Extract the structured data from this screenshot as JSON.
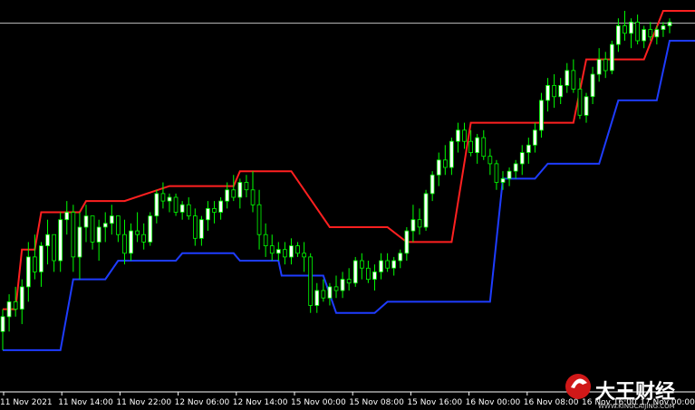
{
  "chart_data": {
    "type": "candlestick",
    "x_tick_labels": [
      "11 Nov 2021",
      "11 Nov 14:00",
      "11 Nov 22:00",
      "12 Nov 06:00",
      "12 Nov 14:00",
      "15 Nov 00:00",
      "15 Nov 08:00",
      "15 Nov 16:00",
      "16 Nov 00:00",
      "16 Nov 08:00",
      "16 Nov 16:00",
      "17 Nov 00:00"
    ],
    "y_range": [
      0,
      100
    ],
    "grid": false,
    "colors": {
      "background": "#000000",
      "bull_candle": "#ffffff",
      "bear_candle": "#00ff00",
      "wick": "#00ff00",
      "upper_channel": "#ff2020",
      "lower_channel": "#1e3cff",
      "price_line": "#c0c0c0"
    },
    "current_price": 96.7,
    "candles": [
      {
        "o": 14,
        "h": 20,
        "l": 9,
        "c": 18
      },
      {
        "o": 18,
        "h": 24,
        "l": 14,
        "c": 22
      },
      {
        "o": 22,
        "h": 26,
        "l": 18,
        "c": 20
      },
      {
        "o": 20,
        "h": 28,
        "l": 16,
        "c": 26
      },
      {
        "o": 26,
        "h": 38,
        "l": 22,
        "c": 34
      },
      {
        "o": 34,
        "h": 40,
        "l": 28,
        "c": 30
      },
      {
        "o": 30,
        "h": 38,
        "l": 26,
        "c": 37
      },
      {
        "o": 37,
        "h": 44,
        "l": 32,
        "c": 40
      },
      {
        "o": 40,
        "h": 40,
        "l": 30,
        "c": 33
      },
      {
        "o": 33,
        "h": 46,
        "l": 30,
        "c": 44
      },
      {
        "o": 44,
        "h": 49,
        "l": 40,
        "c": 46
      },
      {
        "o": 46,
        "h": 48,
        "l": 30,
        "c": 34
      },
      {
        "o": 34,
        "h": 46,
        "l": 28,
        "c": 42
      },
      {
        "o": 42,
        "h": 48,
        "l": 38,
        "c": 45
      },
      {
        "o": 45,
        "h": 45,
        "l": 36,
        "c": 38
      },
      {
        "o": 38,
        "h": 44,
        "l": 33,
        "c": 42
      },
      {
        "o": 42,
        "h": 46,
        "l": 38,
        "c": 43
      },
      {
        "o": 43,
        "h": 48,
        "l": 40,
        "c": 45
      },
      {
        "o": 45,
        "h": 45,
        "l": 38,
        "c": 40
      },
      {
        "o": 40,
        "h": 44,
        "l": 32,
        "c": 35
      },
      {
        "o": 35,
        "h": 43,
        "l": 33,
        "c": 41
      },
      {
        "o": 41,
        "h": 46,
        "l": 38,
        "c": 40
      },
      {
        "o": 40,
        "h": 43,
        "l": 36,
        "c": 38
      },
      {
        "o": 38,
        "h": 46,
        "l": 37,
        "c": 45
      },
      {
        "o": 45,
        "h": 52,
        "l": 43,
        "c": 51
      },
      {
        "o": 51,
        "h": 54,
        "l": 47,
        "c": 49
      },
      {
        "o": 49,
        "h": 51,
        "l": 46,
        "c": 50
      },
      {
        "o": 50,
        "h": 51,
        "l": 45,
        "c": 46
      },
      {
        "o": 46,
        "h": 49,
        "l": 44,
        "c": 48
      },
      {
        "o": 48,
        "h": 50,
        "l": 44,
        "c": 45
      },
      {
        "o": 45,
        "h": 47,
        "l": 37,
        "c": 39
      },
      {
        "o": 39,
        "h": 45,
        "l": 37,
        "c": 44
      },
      {
        "o": 44,
        "h": 49,
        "l": 41,
        "c": 47
      },
      {
        "o": 47,
        "h": 49,
        "l": 43,
        "c": 46
      },
      {
        "o": 46,
        "h": 50,
        "l": 44,
        "c": 49
      },
      {
        "o": 49,
        "h": 54,
        "l": 47,
        "c": 52
      },
      {
        "o": 52,
        "h": 56,
        "l": 49,
        "c": 50
      },
      {
        "o": 50,
        "h": 55,
        "l": 47,
        "c": 54
      },
      {
        "o": 54,
        "h": 56,
        "l": 50,
        "c": 52
      },
      {
        "o": 52,
        "h": 57,
        "l": 46,
        "c": 48
      },
      {
        "o": 48,
        "h": 52,
        "l": 36,
        "c": 40
      },
      {
        "o": 40,
        "h": 43,
        "l": 34,
        "c": 37
      },
      {
        "o": 37,
        "h": 40,
        "l": 33,
        "c": 35
      },
      {
        "o": 35,
        "h": 38,
        "l": 33,
        "c": 36
      },
      {
        "o": 36,
        "h": 38,
        "l": 32,
        "c": 34
      },
      {
        "o": 34,
        "h": 39,
        "l": 32,
        "c": 37
      },
      {
        "o": 37,
        "h": 38,
        "l": 34,
        "c": 35
      },
      {
        "o": 35,
        "h": 38,
        "l": 30,
        "c": 34
      },
      {
        "o": 34,
        "h": 35,
        "l": 19,
        "c": 21
      },
      {
        "o": 21,
        "h": 27,
        "l": 19,
        "c": 25
      },
      {
        "o": 25,
        "h": 28,
        "l": 22,
        "c": 23
      },
      {
        "o": 23,
        "h": 27,
        "l": 21,
        "c": 26
      },
      {
        "o": 26,
        "h": 29,
        "l": 23,
        "c": 25
      },
      {
        "o": 25,
        "h": 30,
        "l": 23,
        "c": 28
      },
      {
        "o": 28,
        "h": 31,
        "l": 25,
        "c": 27
      },
      {
        "o": 27,
        "h": 34,
        "l": 26,
        "c": 33
      },
      {
        "o": 33,
        "h": 35,
        "l": 28,
        "c": 31
      },
      {
        "o": 31,
        "h": 33,
        "l": 27,
        "c": 28
      },
      {
        "o": 28,
        "h": 32,
        "l": 25,
        "c": 30
      },
      {
        "o": 30,
        "h": 35,
        "l": 28,
        "c": 33
      },
      {
        "o": 33,
        "h": 35,
        "l": 30,
        "c": 31
      },
      {
        "o": 31,
        "h": 34,
        "l": 29,
        "c": 33
      },
      {
        "o": 33,
        "h": 36,
        "l": 31,
        "c": 35
      },
      {
        "o": 35,
        "h": 42,
        "l": 33,
        "c": 41
      },
      {
        "o": 41,
        "h": 48,
        "l": 38,
        "c": 44
      },
      {
        "o": 44,
        "h": 47,
        "l": 40,
        "c": 42
      },
      {
        "o": 42,
        "h": 52,
        "l": 41,
        "c": 51
      },
      {
        "o": 51,
        "h": 57,
        "l": 49,
        "c": 56
      },
      {
        "o": 56,
        "h": 62,
        "l": 53,
        "c": 60
      },
      {
        "o": 60,
        "h": 64,
        "l": 56,
        "c": 58
      },
      {
        "o": 58,
        "h": 66,
        "l": 56,
        "c": 65
      },
      {
        "o": 65,
        "h": 70,
        "l": 62,
        "c": 68
      },
      {
        "o": 68,
        "h": 70,
        "l": 63,
        "c": 65
      },
      {
        "o": 65,
        "h": 68,
        "l": 61,
        "c": 62
      },
      {
        "o": 62,
        "h": 67,
        "l": 59,
        "c": 66
      },
      {
        "o": 66,
        "h": 68,
        "l": 60,
        "c": 61
      },
      {
        "o": 61,
        "h": 63,
        "l": 56,
        "c": 59
      },
      {
        "o": 59,
        "h": 60,
        "l": 52,
        "c": 54
      },
      {
        "o": 54,
        "h": 57,
        "l": 52,
        "c": 55
      },
      {
        "o": 55,
        "h": 58,
        "l": 53,
        "c": 57
      },
      {
        "o": 57,
        "h": 60,
        "l": 55,
        "c": 59
      },
      {
        "o": 59,
        "h": 64,
        "l": 56,
        "c": 62
      },
      {
        "o": 62,
        "h": 66,
        "l": 59,
        "c": 64
      },
      {
        "o": 64,
        "h": 70,
        "l": 62,
        "c": 68
      },
      {
        "o": 68,
        "h": 78,
        "l": 66,
        "c": 76
      },
      {
        "o": 76,
        "h": 82,
        "l": 73,
        "c": 80
      },
      {
        "o": 80,
        "h": 83,
        "l": 74,
        "c": 77
      },
      {
        "o": 77,
        "h": 82,
        "l": 75,
        "c": 80
      },
      {
        "o": 80,
        "h": 86,
        "l": 78,
        "c": 84
      },
      {
        "o": 84,
        "h": 87,
        "l": 78,
        "c": 79
      },
      {
        "o": 79,
        "h": 82,
        "l": 71,
        "c": 72
      },
      {
        "o": 72,
        "h": 78,
        "l": 70,
        "c": 77
      },
      {
        "o": 77,
        "h": 85,
        "l": 75,
        "c": 83
      },
      {
        "o": 83,
        "h": 90,
        "l": 81,
        "c": 87
      },
      {
        "o": 87,
        "h": 89,
        "l": 82,
        "c": 84
      },
      {
        "o": 84,
        "h": 92,
        "l": 83,
        "c": 91
      },
      {
        "o": 91,
        "h": 98,
        "l": 89,
        "c": 96
      },
      {
        "o": 96,
        "h": 100,
        "l": 92,
        "c": 94
      },
      {
        "o": 94,
        "h": 98,
        "l": 90,
        "c": 97
      },
      {
        "o": 97,
        "h": 99,
        "l": 91,
        "c": 92
      },
      {
        "o": 92,
        "h": 96,
        "l": 90,
        "c": 95
      },
      {
        "o": 95,
        "h": 97,
        "l": 92,
        "c": 93
      },
      {
        "o": 93,
        "h": 96,
        "l": 91,
        "c": 95
      },
      {
        "o": 95,
        "h": 97,
        "l": 93,
        "c": 96
      },
      {
        "o": 96,
        "h": 98,
        "l": 94,
        "c": 97
      }
    ],
    "upper_channel": [
      {
        "i": 0,
        "v": 20
      },
      {
        "i": 2,
        "v": 20
      },
      {
        "i": 3,
        "v": 36
      },
      {
        "i": 5,
        "v": 36
      },
      {
        "i": 6,
        "v": 46
      },
      {
        "i": 12,
        "v": 46
      },
      {
        "i": 13,
        "v": 49
      },
      {
        "i": 18,
        "v": 49
      },
      {
        "i": 19,
        "v": 49
      },
      {
        "i": 26,
        "v": 53
      },
      {
        "i": 36,
        "v": 53
      },
      {
        "i": 37,
        "v": 57
      },
      {
        "i": 45,
        "v": 57
      },
      {
        "i": 51,
        "v": 42
      },
      {
        "i": 60,
        "v": 42
      },
      {
        "i": 63,
        "v": 38
      },
      {
        "i": 70,
        "v": 38
      },
      {
        "i": 73,
        "v": 70
      },
      {
        "i": 89,
        "v": 70
      },
      {
        "i": 91,
        "v": 87
      },
      {
        "i": 100,
        "v": 87
      },
      {
        "i": 103,
        "v": 100
      },
      {
        "i": 108,
        "v": 100
      }
    ],
    "lower_channel": [
      {
        "i": 0,
        "v": 9
      },
      {
        "i": 9,
        "v": 9
      },
      {
        "i": 11,
        "v": 28
      },
      {
        "i": 16,
        "v": 28
      },
      {
        "i": 18,
        "v": 33
      },
      {
        "i": 27,
        "v": 33
      },
      {
        "i": 28,
        "v": 35
      },
      {
        "i": 36,
        "v": 35
      },
      {
        "i": 37,
        "v": 33
      },
      {
        "i": 43,
        "v": 33
      },
      {
        "i": 43.5,
        "v": 29
      },
      {
        "i": 50,
        "v": 29
      },
      {
        "i": 52,
        "v": 19
      },
      {
        "i": 58,
        "v": 19
      },
      {
        "i": 60,
        "v": 22
      },
      {
        "i": 76,
        "v": 22
      },
      {
        "i": 78,
        "v": 55
      },
      {
        "i": 83,
        "v": 55
      },
      {
        "i": 85,
        "v": 59
      },
      {
        "i": 93,
        "v": 59
      },
      {
        "i": 96,
        "v": 76
      },
      {
        "i": 102,
        "v": 76
      },
      {
        "i": 104,
        "v": 92
      },
      {
        "i": 108,
        "v": 92
      }
    ]
  },
  "watermark": {
    "brand_text": "大王财经",
    "sub_text": "WWW.KINGCAIJING.COM"
  }
}
